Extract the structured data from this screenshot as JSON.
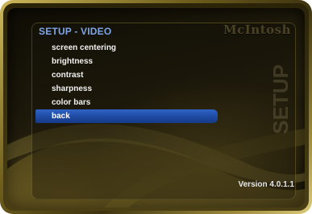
{
  "header": {
    "title": "SETUP - VIDEO",
    "brand": "McIntosh"
  },
  "watermark": "SETUP",
  "menu": {
    "items": [
      {
        "label": "screen centering"
      },
      {
        "label": "brightness"
      },
      {
        "label": "contrast"
      },
      {
        "label": "sharpness"
      },
      {
        "label": "color bars"
      },
      {
        "label": "back"
      }
    ],
    "selected_index": 5
  },
  "footer": {
    "version": "Version 4.0.1.1"
  },
  "colors": {
    "title": "#7fa6e8",
    "selection": "#2f63c6",
    "frame_gold": "#9c8a3a"
  }
}
